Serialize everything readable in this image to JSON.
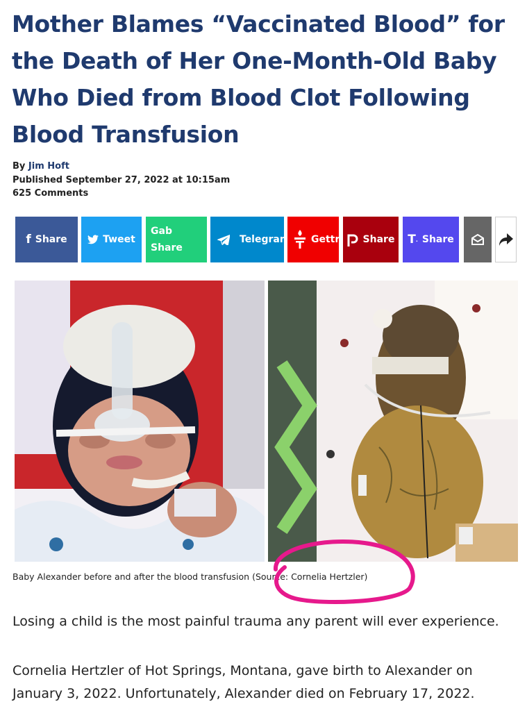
{
  "article": {
    "headline": "Mother Blames “Vaccinated Blood” for the Death of Her One-Month-Old Baby Who Died from Blood Clot Following Blood Transfusion",
    "byline_prefix": "By",
    "author": "Jim Hoft",
    "published": "Published September 27, 2022 at 10:15am",
    "comments": "625 Comments"
  },
  "share_bar": [
    {
      "id": "facebook",
      "label": "Share",
      "icon": "facebook-icon",
      "color": "#3b5998"
    },
    {
      "id": "twitter",
      "label": "Tweet",
      "icon": "twitter-icon",
      "color": "#1da1f2"
    },
    {
      "id": "gab",
      "label": "Gab Share",
      "icon": "",
      "color": "#21cf7b"
    },
    {
      "id": "telegram",
      "label": "Telegram",
      "icon": "telegram-icon",
      "color": "#0088cc"
    },
    {
      "id": "gettr",
      "label": "Gettr",
      "icon": "gettr-icon",
      "color": "#f00000"
    },
    {
      "id": "parler",
      "label": "Share",
      "icon": "parler-icon",
      "color": "#a9000d"
    },
    {
      "id": "truth",
      "label": "Share",
      "icon": "truth-social-icon",
      "color": "#5448ee"
    },
    {
      "id": "email",
      "label": "",
      "icon": "email-icon",
      "color": "#666666"
    },
    {
      "id": "more",
      "label": "",
      "icon": "share-arrow-icon",
      "color": "#ffffff"
    }
  ],
  "image_caption": "Baby Alexander before and after the blood transfusion (Source: Cornelia Hertzler)",
  "paragraphs": [
    "Losing a child is the most painful trauma any parent will ever experience.",
    "Cornelia Hertzler of Hot Springs, Montana, gave birth to Alexander on January 3, 2022. Unfortunately, Alexander died on February 17, 2022."
  ],
  "colors": {
    "headline": "#1f3a6e",
    "annotation_circle": "#e6198c"
  }
}
